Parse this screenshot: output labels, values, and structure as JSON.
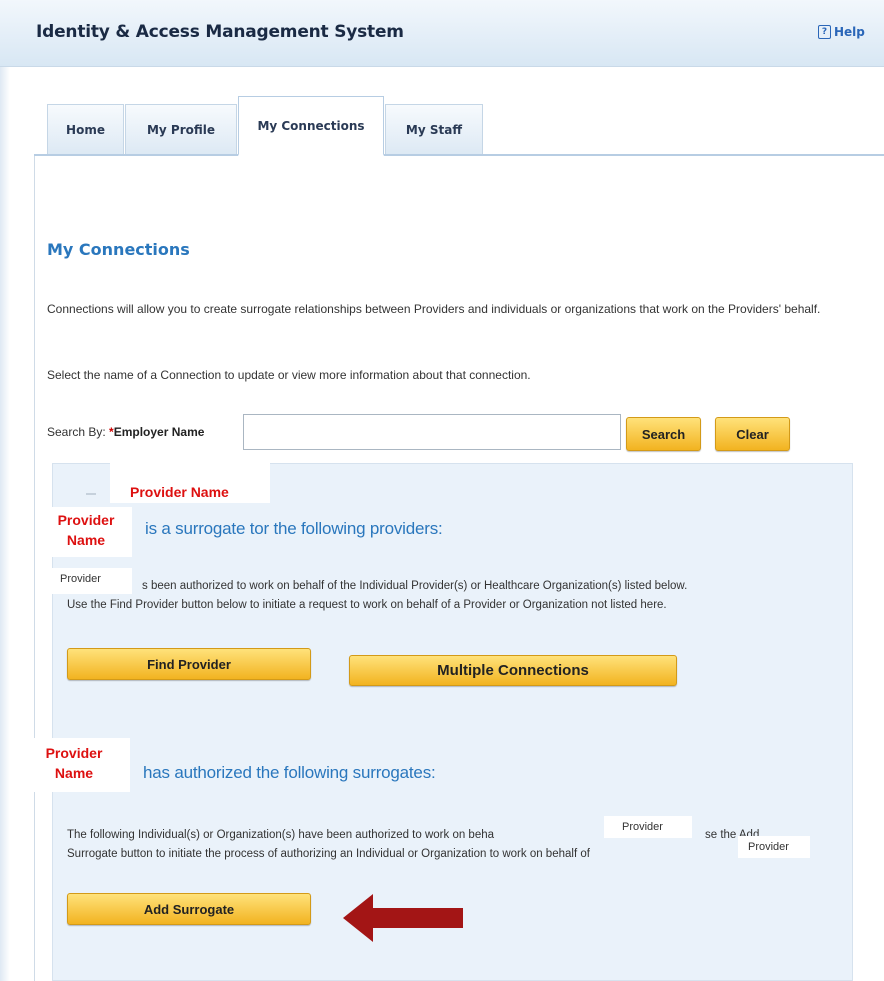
{
  "header": {
    "app_title": "Identity & Access Management System",
    "help_label": "Help",
    "help_icon": "?"
  },
  "tabs": [
    {
      "label": "Home",
      "active": false
    },
    {
      "label": "My Profile",
      "active": false
    },
    {
      "label": "My Connections",
      "active": true
    },
    {
      "label": "My Staff",
      "active": false
    }
  ],
  "main": {
    "title": "My Connections",
    "description": "Connections will allow you to create surrogate relationships between Providers and individuals or organizations that work on the Providers' behalf.",
    "instruction": "Select the name of a Connection to update or view more information about that connection.",
    "search": {
      "label": "Search By:",
      "required_marker": "*",
      "field_label": "Employer Name",
      "value": "",
      "search_button": "Search",
      "clear_button": "Clear"
    }
  },
  "surrogate_section": {
    "provider_name_header": "Provider Name",
    "provider_name_label_line1": "Provider",
    "provider_name_label_line2": "Name",
    "heading": "is a surrogate tor the following providers:",
    "provider_chip": "Provider",
    "text_line1": "s been authorized to work on behalf of the Individual Provider(s) or Healthcare Organization(s) listed below.",
    "text_line2": "Use the Find Provider button below to initiate a request to work on behalf of a Provider or Organization not listed here.",
    "find_provider_button": "Find Provider",
    "multiple_connections_button": "Multiple Connections"
  },
  "authorized_section": {
    "provider_name_label_line1": "Provider",
    "provider_name_label_line2": "Name",
    "heading": "has authorized the following surrogates:",
    "text_line1_part1": "The following Individual(s) or Organization(s) have been authorized to work on beha",
    "chip_1": "Provider",
    "text_line1_part2": "se the Add",
    "text_line2": "Surrogate button to initiate the process of authorizing an Individual or Organization to work on behalf of",
    "chip_2": "Provider",
    "add_surrogate_button": "Add Surrogate"
  },
  "colors": {
    "accent_blue": "#2a77bd",
    "button_gold": "#f2b320",
    "label_red": "#dd1010",
    "arrow_red": "#a31515"
  },
  "icons": {
    "help": "help-icon",
    "arrow": "arrow-left-icon"
  }
}
